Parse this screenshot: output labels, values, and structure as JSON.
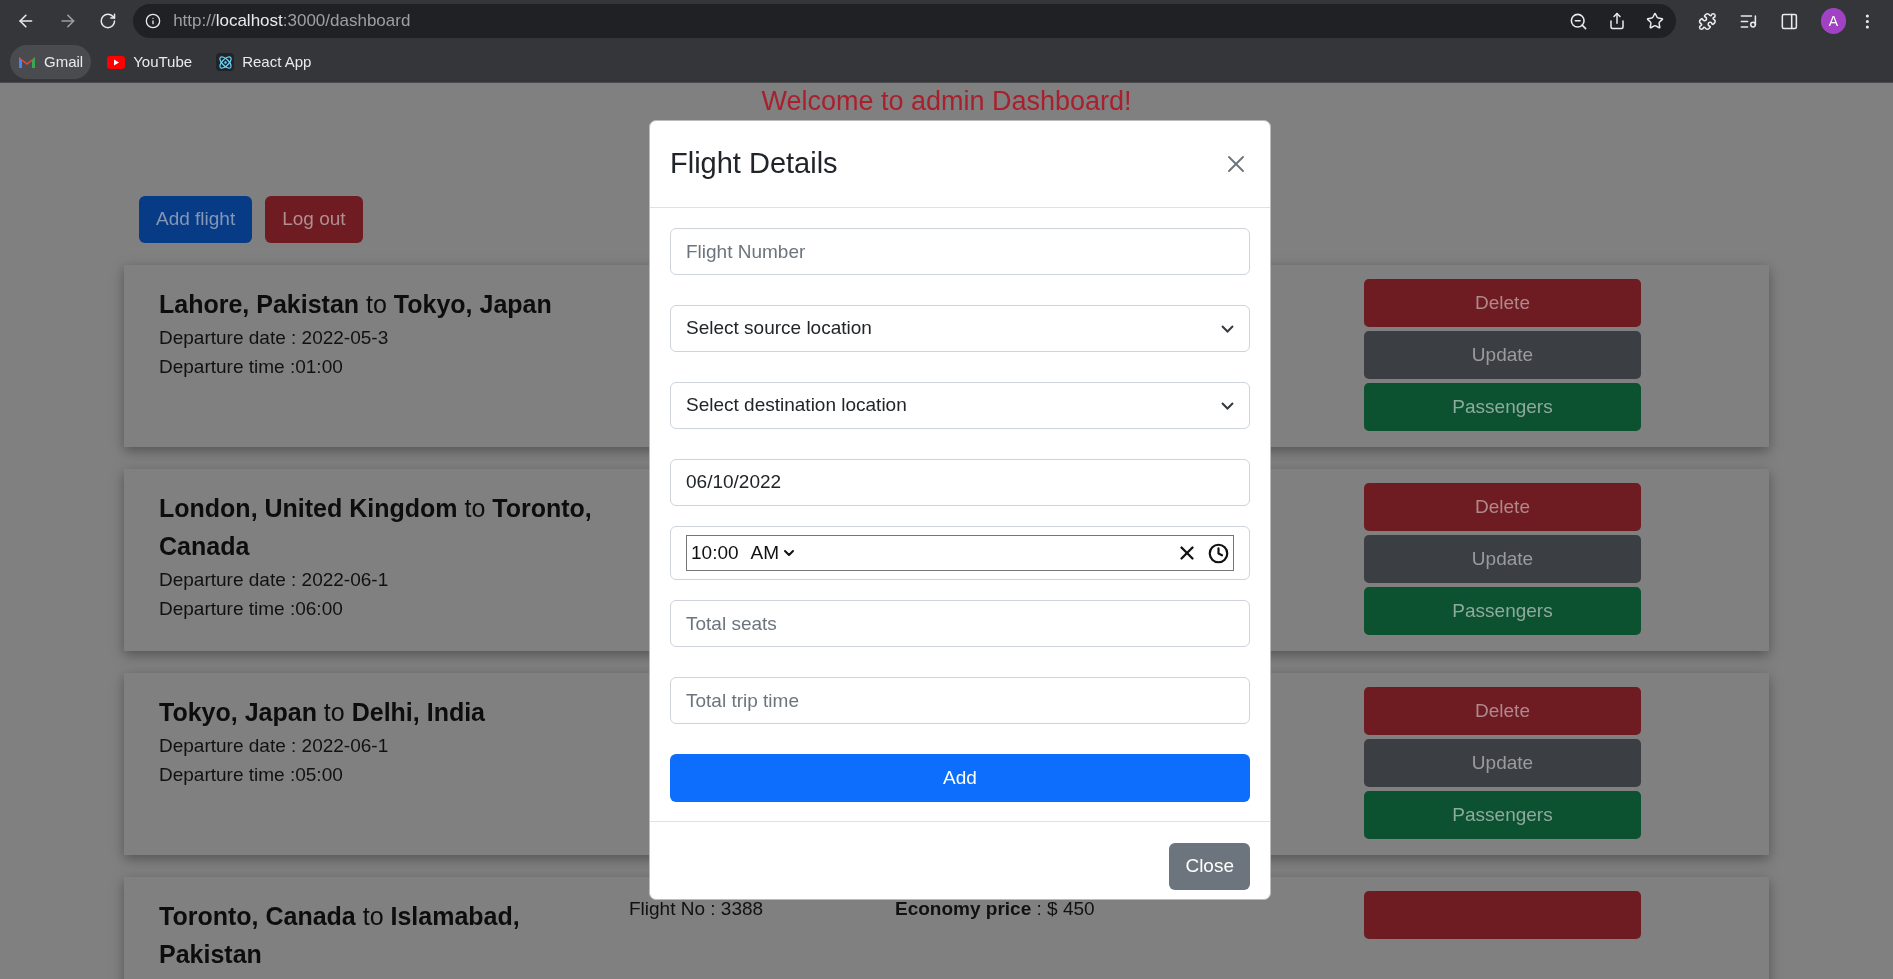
{
  "browser": {
    "url": {
      "scheme": "http://",
      "host": "localhost",
      "path": ":3000/dashboard"
    },
    "bookmarks": [
      {
        "label": "Gmail"
      },
      {
        "label": "YouTube"
      },
      {
        "label": "React App"
      }
    ],
    "profile": "A"
  },
  "page": {
    "title": "Welcome to admin Dashboard!",
    "buttons": [
      {
        "label": "Add flight",
        "kind": "primary"
      },
      {
        "label": "Log out",
        "kind": "danger"
      }
    ],
    "flights": [
      {
        "route": "**Lahore, Pakistan** to **Tokyo, Japan**",
        "departure_date": "Departure date : 2022-05-3",
        "departure_time": "Departure time :01:00",
        "actions": [
          "Delete",
          "Update",
          "Passengers"
        ]
      },
      {
        "route": "**London, United Kingdom** to **Toronto, Canada**",
        "departure_date": "Departure date : 2022-06-1",
        "departure_time": "Departure time :06:00",
        "actions": [
          "Delete",
          "Update",
          "Passengers"
        ]
      },
      {
        "route": "**Tokyo, Japan** to **Delhi, India**",
        "departure_date": "Departure date : 2022-06-1",
        "departure_time": "Departure time :05:00",
        "actions": [
          "Delete",
          "Update",
          "Passengers"
        ]
      },
      {
        "route": "**Toronto, Canada** to **Islamabad, Pakistan**",
        "flight_no": "Flight No : 3388",
        "economy_price": "**Economy price** : $ 450",
        "cut_off_button": true
      }
    ]
  },
  "modal": {
    "title": "Flight Details",
    "fields": [
      {
        "kind": "input",
        "placeholder": "Flight Number"
      },
      {
        "kind": "select",
        "value": "Select source location"
      },
      {
        "kind": "select",
        "value": "Select destination location"
      },
      {
        "kind": "date",
        "value": "06/10/2022"
      },
      {
        "kind": "time",
        "value": "10:00",
        "period": "AM"
      },
      {
        "kind": "input",
        "placeholder": "Total seats"
      },
      {
        "kind": "input",
        "placeholder": "Total trip time"
      }
    ],
    "submit": "Add",
    "close": "Close"
  }
}
